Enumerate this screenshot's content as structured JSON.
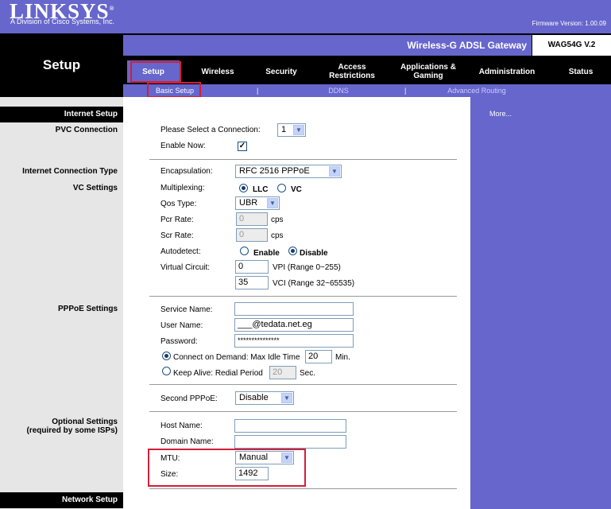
{
  "header": {
    "logo": "LINKSYS",
    "logo_trademark": "®",
    "logo_subtitle": "A Division of Cisco Systems, Inc.",
    "firmware": "Firmware Version: 1.00.09",
    "section_title": "Setup",
    "product_name": "Wireless-G ADSL Gateway",
    "model": "WAG54G V.2"
  },
  "tabs": [
    {
      "label": "Setup"
    },
    {
      "label": "Wireless"
    },
    {
      "label": "Security"
    },
    {
      "label": "Access Restrictions"
    },
    {
      "label": "Applications & Gaming"
    },
    {
      "label": "Administration"
    },
    {
      "label": "Status"
    }
  ],
  "subtabs": [
    {
      "label": "Basic Setup"
    },
    {
      "label": "DDNS"
    },
    {
      "label": "Advanced Routing"
    }
  ],
  "subtab_separator": "|",
  "sidebar": {
    "internet_setup": "Internet Setup",
    "pvc_connection": "PVC Connection",
    "internet_connection_type": "Internet Connection Type",
    "vc_settings": "VC Settings",
    "pppoe_settings": "PPPoE Settings",
    "optional_settings": "Optional Settings",
    "optional_settings_note": "(required by some ISPs)",
    "network_setup": "Network Setup"
  },
  "more_link": "More...",
  "pvc": {
    "select_label": "Please Select a Connection:",
    "select_value": "1",
    "enable_label": "Enable Now:",
    "enable_checked": "✓"
  },
  "vc": {
    "encapsulation_label": "Encapsulation:",
    "encapsulation_value": "RFC 2516 PPPoE",
    "multiplexing_label": "Multiplexing:",
    "llc_label": "LLC",
    "vc_label": "VC",
    "qos_label": "Qos Type:",
    "qos_value": "UBR",
    "pcr_label": "Pcr Rate:",
    "pcr_value": "0",
    "scr_label": "Scr Rate:",
    "scr_value": "0",
    "cps_unit": "cps",
    "autodetect_label": "Autodetect:",
    "enable_label": "Enable",
    "disable_label": "Disable",
    "virtual_circuit_label": "Virtual Circuit:",
    "vpi_value": "0",
    "vpi_range": "VPI (Range 0~255)",
    "vci_value": "35",
    "vci_range": "VCI (Range 32~65535)"
  },
  "pppoe": {
    "service_name_label": "Service Name:",
    "service_name_value": "",
    "user_name_label": "User Name:",
    "user_name_value": "___@tedata.net.eg",
    "password_label": "Password:",
    "password_value": "***************",
    "connect_on_demand_label": "Connect on Demand: Max Idle Time",
    "max_idle_value": "20",
    "min_unit": "Min.",
    "keep_alive_label": "Keep Alive: Redial Period",
    "redial_value": "20",
    "sec_unit": "Sec."
  },
  "second_pppoe": {
    "label": "Second PPPoE:",
    "value": "Disable"
  },
  "optional": {
    "host_name_label": "Host Name:",
    "host_name_value": "",
    "domain_name_label": "Domain Name:",
    "domain_name_value": "",
    "mtu_label": "MTU:",
    "mtu_value": "Manual",
    "size_label": "Size:",
    "size_value": "1492"
  },
  "colors": {
    "brand_purple": "#6666cc",
    "highlight_red": "#d0203a",
    "black": "#000000"
  }
}
